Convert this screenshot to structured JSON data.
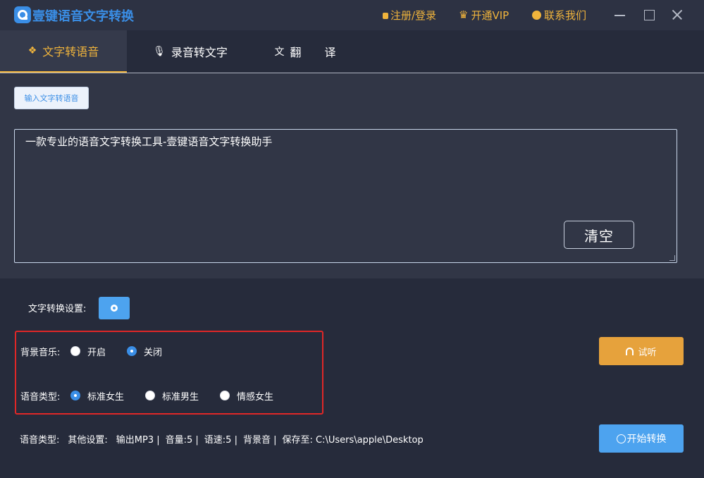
{
  "app": {
    "title": "壹键语音文字转换",
    "logo_icon": "speech-bubble-icon",
    "brand_color": "#3a8ee6",
    "accent_color": "#f0b43c"
  },
  "header": {
    "login": "注册/登录",
    "vip": "开通VIP",
    "contact": "联系我们"
  },
  "tabs": [
    {
      "label": "文字转语音",
      "icon": "text-to-speech-icon",
      "active": true
    },
    {
      "label": "录音转文字",
      "icon": "microphone-icon",
      "active": false
    },
    {
      "label": "翻 译",
      "icon": "translate-icon",
      "active": false
    }
  ],
  "editor": {
    "mode_button": "输入文字转语音",
    "text": "一款专业的语音文字转换工具-壹键语音文字转换助手",
    "clear_button": "清空"
  },
  "settings": {
    "label": "文字转换设置:",
    "background_music": {
      "label": "背景音乐:",
      "options": [
        "开启",
        "关闭"
      ],
      "selected": "关闭"
    },
    "voice_type": {
      "label": "语音类型:",
      "options": [
        "标准女生",
        "标准男生",
        "情感女生"
      ],
      "selected": "标准女生"
    },
    "listen_button": "试听"
  },
  "status": {
    "voice_type": "语音类型:",
    "other_settings": "其他设置:",
    "output": "输出MP3 |",
    "volume": "音量:5 |",
    "speed": "语速:5 |",
    "bgm": "背景音 |",
    "save_to": "保存至: C:\\Users\\apple\\Desktop"
  },
  "start_button": "开始转换"
}
